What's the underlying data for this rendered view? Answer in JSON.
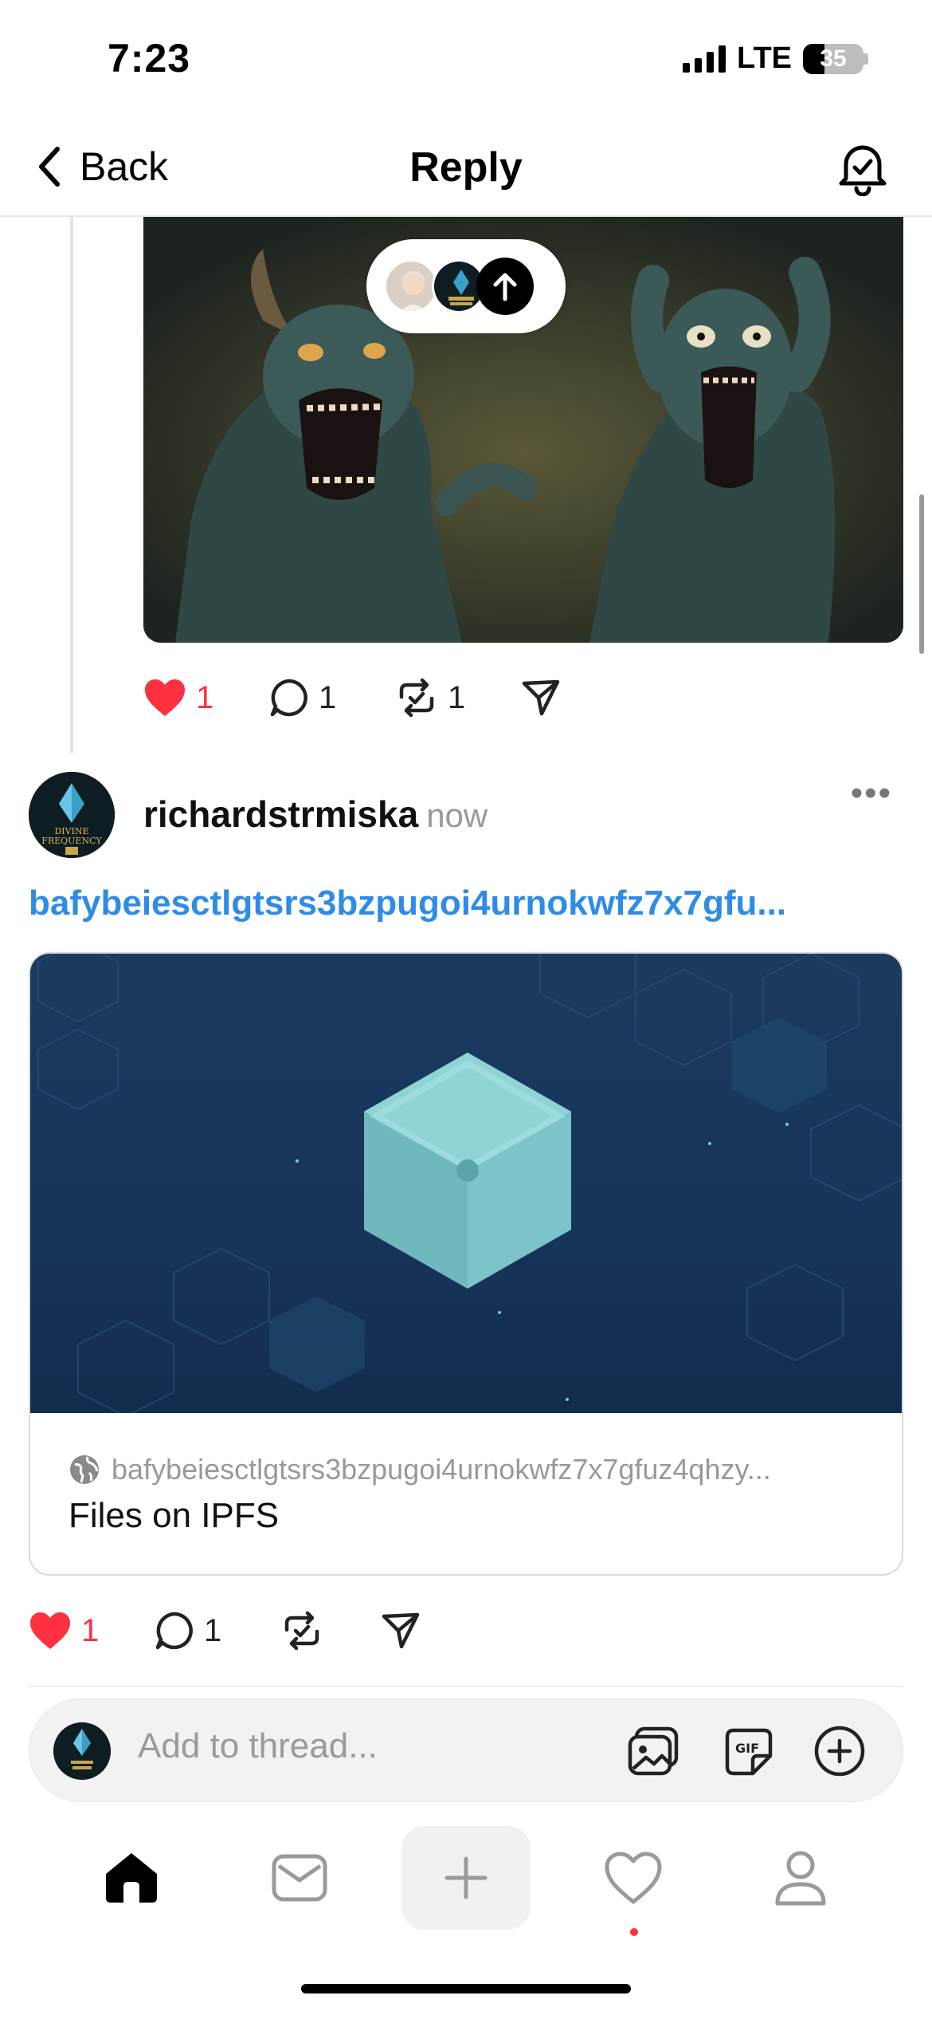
{
  "status_bar": {
    "time": "7:23",
    "network": "LTE",
    "battery": "35"
  },
  "header": {
    "back_label": "Back",
    "title": "Reply"
  },
  "previous_post": {
    "likes": "1",
    "replies": "1",
    "reposts": "1"
  },
  "post": {
    "username": "richardstrmiska",
    "time": "now",
    "more": "•••",
    "link_text": "bafybeiesctlgtsrs3bzpugoi4urnokwfz7x7gfu...",
    "card": {
      "url": "bafybeiesctlgtsrs3bzpugoi4urnokwfz7x7gfuz4qhzy...",
      "title": "Files on IPFS"
    },
    "likes": "1",
    "replies": "1"
  },
  "composer": {
    "placeholder": "Add to thread...",
    "gif_label": "GIF"
  },
  "colors": {
    "like": "#ff3040",
    "link": "#2e8ce6",
    "card_bg": "#17345a",
    "cube": "#7cc4c9"
  },
  "tabs": [
    "home-icon",
    "inbox-icon",
    "new-post-icon",
    "activity-icon",
    "profile-icon"
  ]
}
